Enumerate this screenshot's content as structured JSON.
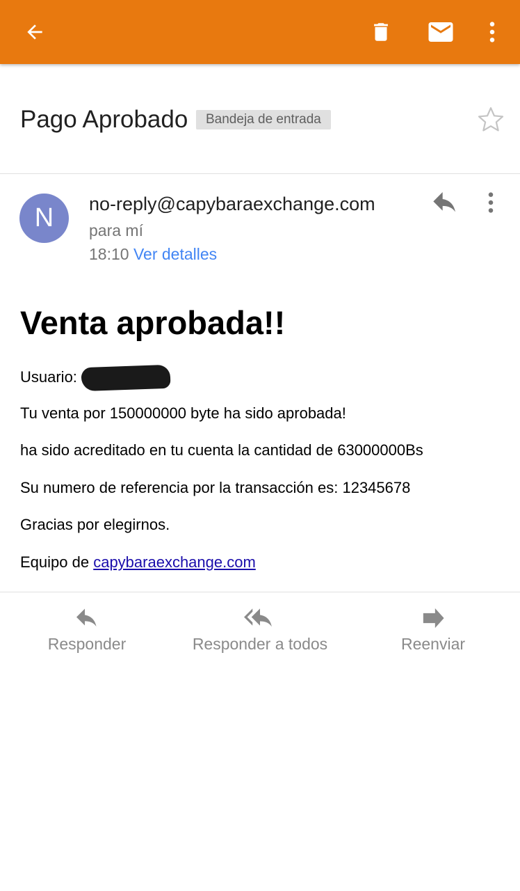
{
  "appbar": {
    "color": "#e8790f",
    "back_icon": "arrow-left-icon",
    "delete_icon": "trash-icon",
    "mark_unread_icon": "envelope-icon",
    "more_icon": "more-vert-icon"
  },
  "subject": {
    "title": "Pago Aprobado",
    "label": "Bandeja de entrada",
    "star_icon": "star-outline-icon"
  },
  "message": {
    "avatar_letter": "N",
    "avatar_color": "#7986cb",
    "sender": "no-reply@capybaraexchange.com",
    "recipient": "para mí",
    "time": "18:10",
    "details_link": "Ver detalles",
    "reply_icon": "reply-icon",
    "more_icon": "more-vert-icon"
  },
  "body": {
    "heading": "Venta aprobada!!",
    "user_label": "Usuario:",
    "line1": "Tu venta por 150000000 byte ha sido aprobada!",
    "line2": "ha sido acreditado en tu cuenta la cantidad de 63000000Bs",
    "line3": "Su numero de referencia por la transacción es: 12345678",
    "line4": "Gracias por elegirnos.",
    "signature_prefix": "Equipo de ",
    "signature_link": "capybaraexchange.com"
  },
  "actions": {
    "reply": "Responder",
    "reply_all": "Responder a todos",
    "forward": "Reenviar"
  }
}
